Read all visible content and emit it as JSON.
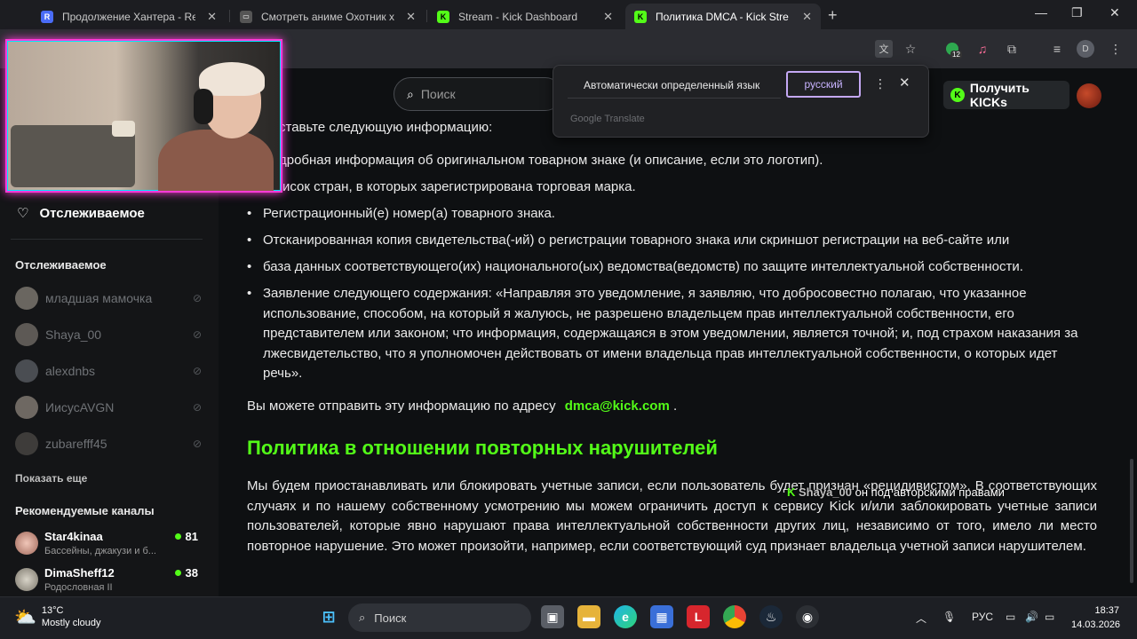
{
  "tabs": [
    {
      "label": "Продолжение Хантера - Restr",
      "favicon": "R"
    },
    {
      "label": "Смотреть аниме Охотник х Ох",
      "favicon": "film"
    },
    {
      "label": "Stream - Kick Dashboard",
      "favicon": "K"
    },
    {
      "label": "Политика DMCA - Kick Stream",
      "favicon": "K"
    }
  ],
  "toolbar": {
    "extension_badge": "12",
    "profile_initial": "D"
  },
  "header": {
    "search_placeholder": "Поиск",
    "get_kicks": "Получить KICKs"
  },
  "translate_popup": {
    "auto_detected": "Автоматически определенный язык",
    "selected_language": "русский",
    "brand": "Google Translate"
  },
  "sidebar": {
    "following_nav": "Отслеживаемое",
    "following_heading": "Отслеживаемое",
    "following": [
      "младшая мамочка",
      "Shaya_00",
      "alexdnbs",
      "ИисусAVGN",
      "zubarefff45"
    ],
    "show_more": "Показать еще",
    "recommended_heading": "Рекомендуемые каналы",
    "recommended": [
      {
        "name": "Star4kinaa",
        "sub": "Бассейны, джакузи и б...",
        "viewers": "81"
      },
      {
        "name": "DimaSheff12",
        "sub": "Родословная II",
        "viewers": "38"
      }
    ]
  },
  "content": {
    "intro": "ставьте следующую информацию:",
    "bullets": [
      "дробная информация об оригинальном товарном знаке (и описание, если это логотип).",
      "исок стран, в которых зарегистрирована торговая марка.",
      "Регистрационный(е) номер(а) товарного знака.",
      "Отсканированная копия свидетельства(-ий) о регистрации товарного знака или скриншот регистрации на веб-сайте или",
      "база данных соответствующего(их) национального(ых) ведомства(ведомств) по защите интеллектуальной собственности.",
      "Заявление следующего содержания: «Направляя это уведомление, я заявляю, что добросовестно полагаю, что указанное использование, способом, на который я жалуюсь, не разрешено владельцем прав интеллектуальной собственности, его представителем или законом; что информация, содержащаяся в этом уведомлении, является точной; и, под страхом наказания за лжесвидетельство, что я уполномочен действовать от имени владельца прав интеллектуальной собственности, о которых идет речь»."
    ],
    "send_prefix": "Вы можете отправить эту информацию по адресу",
    "email": "dmca@kick.com",
    "send_suffix": ".",
    "heading": "Политика в отношении повторных нарушителей",
    "paragraph": "Мы будем приостанавливать или блокировать учетные записи, если пользователь будет признан «рецидивистом». В соответствующих случаях и по нашему собственному усмотрению мы можем ограничить доступ к сервису Kick и/или заблокировать учетные записи пользователей, которые явно нарушают права интеллектуальной собственности других лиц, независимо от того, имело ли место повторное нарушение. Это может произойти, например, если соответствующий суд признает владельца учетной записи нарушителем."
  },
  "chat_overlay": {
    "name": "Shaya_00",
    "message": "он под авторскими правами"
  },
  "taskbar": {
    "temp": "13°C",
    "weather": "Mostly cloudy",
    "search": "Поиск",
    "lang": "РУС",
    "time": "18:37",
    "date": "14.03.2026"
  },
  "colors": {
    "accent": "#53fc18",
    "highlight_border": "#c4a8f4",
    "cam_border": "#ff3bd9"
  }
}
